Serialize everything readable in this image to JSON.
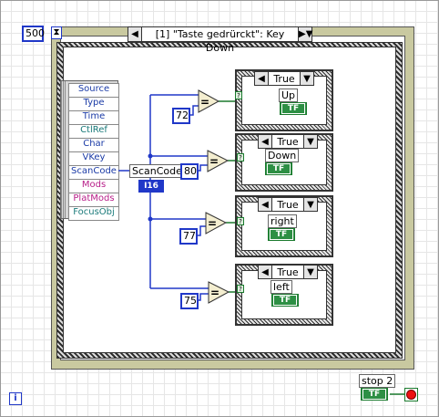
{
  "loop": {
    "count_value": "500"
  },
  "event_structure": {
    "selector_label": "[1] \"Taste gedrürckt\": Key Down",
    "left_arrow": "◀",
    "right_arrow": "▶",
    "down_arrow": "▼",
    "event_data_fields": [
      "Source",
      "Type",
      "Time",
      "CtlRef",
      "Char",
      "VKey",
      "ScanCode",
      "Mods",
      "PlatMods",
      "FocusObj"
    ],
    "event_data_colors": [
      "#1a3aa6",
      "#1a3aa6",
      "#1a3aa6",
      "#1a7a7a",
      "#1a3aa6",
      "#1a3aa6",
      "#1a3aa6",
      "#b8208a",
      "#b8208a",
      "#1a7a7a"
    ]
  },
  "scancode": {
    "label": "ScanCode",
    "type": "I16"
  },
  "comparisons": [
    {
      "constant": "72",
      "case_value": "True",
      "string": "Up",
      "bool": "TF"
    },
    {
      "constant": "80",
      "case_value": "True",
      "string": "Down",
      "bool": "TF"
    },
    {
      "constant": "77",
      "case_value": "True",
      "string": "right",
      "bool": "TF"
    },
    {
      "constant": "75",
      "case_value": "True",
      "string": "left",
      "bool": "TF"
    }
  ],
  "stop": {
    "label": "stop 2",
    "bool": "TF"
  },
  "iteration": {
    "label": "i"
  },
  "colors": {
    "wire_blue": "#2038c8",
    "wire_green": "#1b7a2e",
    "loop_tan": "#c9c9a0"
  }
}
